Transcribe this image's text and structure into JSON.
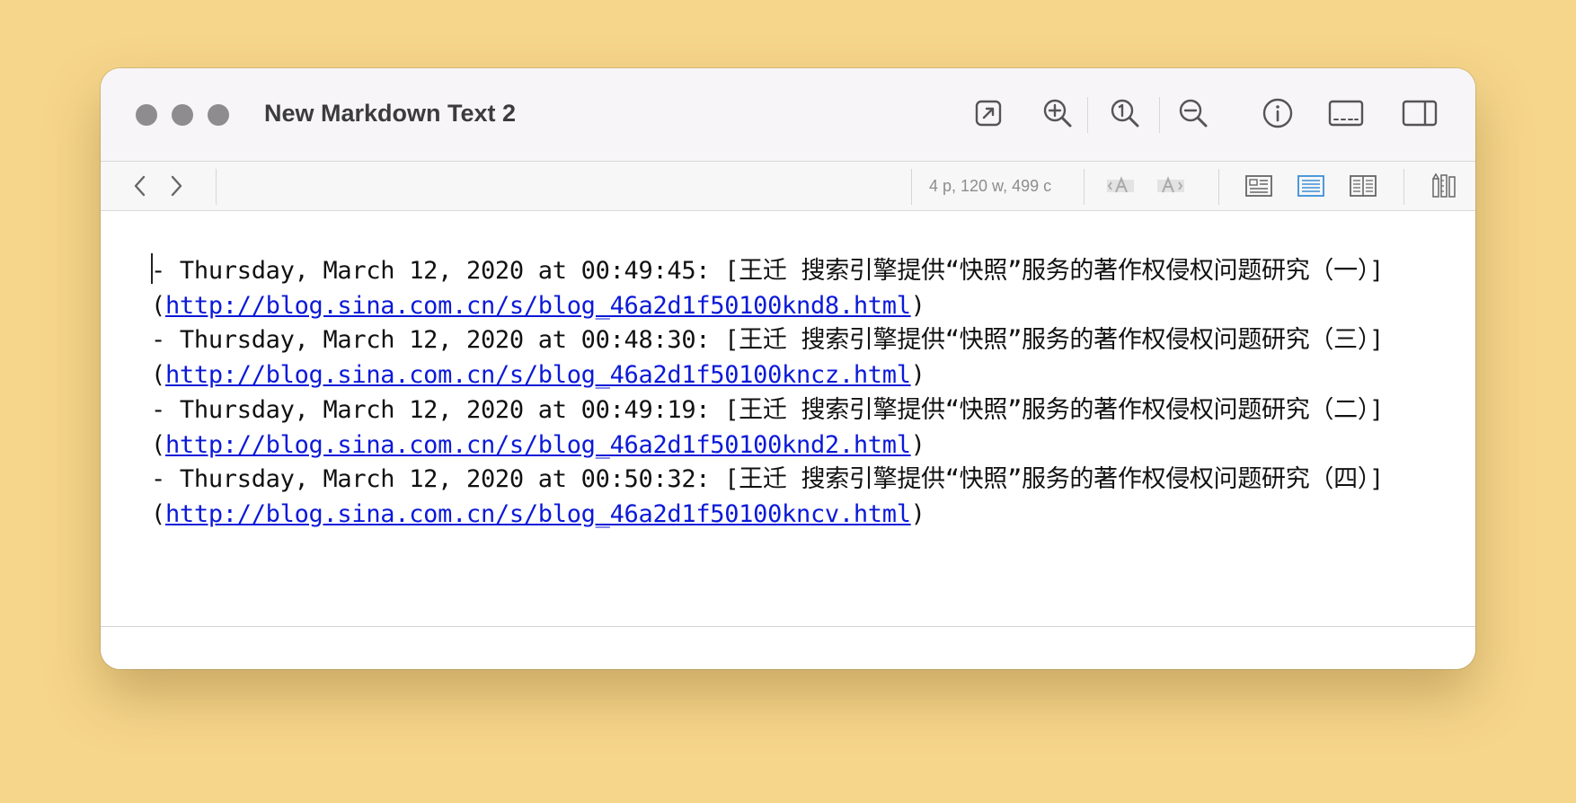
{
  "window": {
    "title": "New Markdown Text 2"
  },
  "toolbar": {
    "icons": [
      "open-external-icon",
      "zoom-in-icon",
      "actual-size-icon",
      "zoom-out-icon",
      "info-icon",
      "footer-bar-icon",
      "sidebar-icon"
    ]
  },
  "secondary_toolbar": {
    "stats": "4 p, 120 w, 499 c",
    "font_smaller": "<A",
    "font_larger": "A>"
  },
  "document": {
    "lines": [
      {
        "prefix": "- Thursday, March 12, 2020 at 00:49:45: [王迁 搜索引擎提供“快照”服务的著作权侵权问题研究（一）]",
        "open": "(",
        "url": "http://blog.sina.com.cn/s/blog_46a2d1f50100knd8.html",
        "close": ")"
      },
      {
        "prefix": "- Thursday, March 12, 2020 at 00:48:30: [王迁 搜索引擎提供“快照”服务的著作权侵权问题研究（三）]",
        "open": "(",
        "url": "http://blog.sina.com.cn/s/blog_46a2d1f50100kncz.html",
        "close": ")"
      },
      {
        "prefix": "- Thursday, March 12, 2020 at 00:49:19: [王迁 搜索引擎提供“快照”服务的著作权侵权问题研究（二）]",
        "open": "(",
        "url": "http://blog.sina.com.cn/s/blog_46a2d1f50100knd2.html",
        "close": ")"
      },
      {
        "prefix": "- Thursday, March 12, 2020 at 00:50:32: [王迁 搜索引擎提供“快照”服务的著作权侵权问题研究（四）]",
        "open": "(",
        "url": "http://blog.sina.com.cn/s/blog_46a2d1f50100kncv.html",
        "close": ")"
      }
    ]
  },
  "colors": {
    "background": "#f6d68b",
    "link": "#0b19d8",
    "accent": "#3a8fd6"
  }
}
